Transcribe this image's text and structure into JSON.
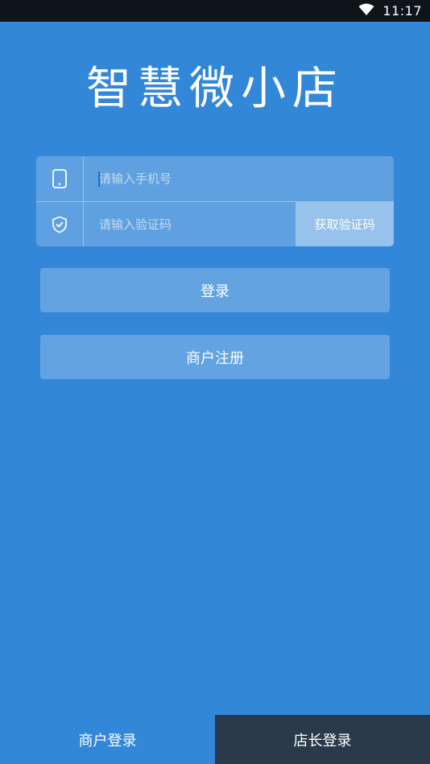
{
  "status_bar": {
    "time": "11:17",
    "icons": [
      "wifi-icon",
      "battery-icon"
    ]
  },
  "app": {
    "logo_text": "智慧微小店"
  },
  "login_form": {
    "phone_placeholder": "请输入手机号",
    "code_placeholder": "请输入验证码",
    "get_code_label": "获取验证码",
    "phone_icon": "phone-icon",
    "code_icon": "shield-check-icon"
  },
  "buttons": {
    "login_label": "登录",
    "register_label": "商户注册"
  },
  "bottom_tabs": [
    {
      "label": "商户登录",
      "active": false
    },
    {
      "label": "店长登录",
      "active": true
    }
  ],
  "colors": {
    "background": "#3287d8",
    "status_bar": "#0f1419",
    "active_tab": "#2a3a4a"
  }
}
